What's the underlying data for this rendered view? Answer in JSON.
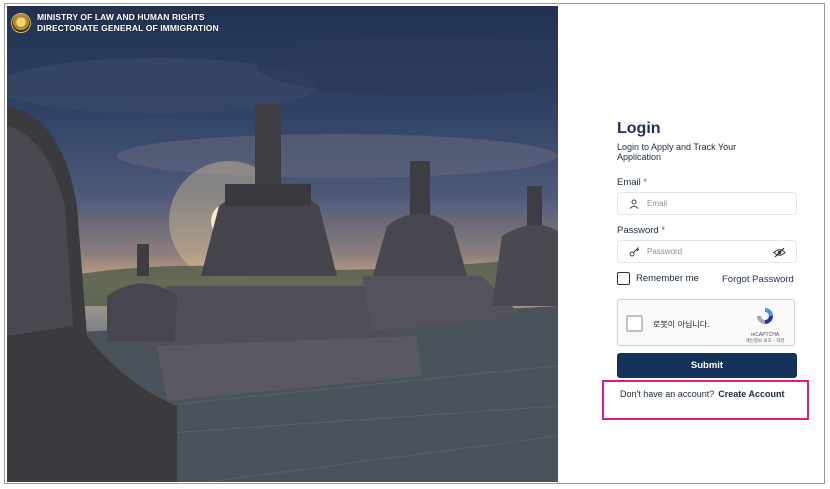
{
  "header": {
    "line1": "MINISTRY OF LAW AND HUMAN RIGHTS",
    "line2": "DIRECTORATE GENERAL OF IMMIGRATION"
  },
  "login": {
    "title": "Login",
    "subtitle": "Login to Apply and Track Your Application",
    "email_label": "Email",
    "email_placeholder": "Email",
    "password_label": "Password",
    "password_placeholder": "Password",
    "required_mark": "*",
    "remember_label": "Remember me",
    "forgot_label": "Forgot Password",
    "submit_label": "Submit",
    "no_account_text": "Don't have an account?",
    "create_account_label": "Create Account"
  },
  "captcha": {
    "label": "로봇이 아닙니다.",
    "brand": "reCAPTCHA",
    "terms": "개인정보 보호 - 약관"
  },
  "icons": {
    "email": "user-icon",
    "password": "key-icon",
    "toggle": "eye-slash-icon",
    "captcha": "recaptcha-icon"
  },
  "colors": {
    "primary": "#14325a",
    "highlight": "#e0168c",
    "required": "#d0342c"
  }
}
